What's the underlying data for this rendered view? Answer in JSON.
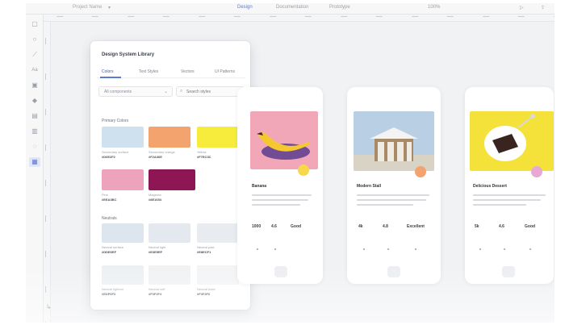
{
  "toolbar": {
    "file_title": "Project Name",
    "file_caret": "▾",
    "tabs": [
      {
        "label": "Design"
      },
      {
        "label": "Documentation"
      },
      {
        "label": "Prototype"
      }
    ],
    "zoom": "100%",
    "icons": [
      "play-icon",
      "share-icon"
    ]
  },
  "rail": {
    "tools": [
      {
        "name": "select-tool-icon",
        "glyph": "▢"
      },
      {
        "name": "ellipse-tool-icon",
        "glyph": "○"
      },
      {
        "name": "pen-tool-icon",
        "glyph": "⟋"
      },
      {
        "name": "text-tool-icon",
        "glyph": "Aa"
      },
      {
        "name": "image-tool-icon",
        "glyph": "▣"
      },
      {
        "name": "component-tool-icon",
        "glyph": "◆"
      },
      {
        "name": "grid-tool-icon",
        "glyph": "▤"
      },
      {
        "name": "layers-tool-icon",
        "glyph": "▥"
      },
      {
        "name": "comment-tool-icon",
        "glyph": "◌"
      },
      {
        "name": "library-tool-icon",
        "glyph": "▦",
        "active": true
      }
    ],
    "bottom_tool": {
      "name": "help-icon",
      "glyph": "↳"
    }
  },
  "library": {
    "title": "Design System Library",
    "tabs": [
      "Colors",
      "Text Styles",
      "Vectors",
      "UI Patterns"
    ],
    "active_tab": "Colors",
    "filter": {
      "value": "All components"
    },
    "search": {
      "placeholder": "Search styles"
    },
    "primary_label": "Primary Colors",
    "neutral_label": "Neutrals",
    "primary_colors": [
      {
        "color": "#cfe0ef",
        "caption": "Secondary surface",
        "code": "#D0E2F2"
      },
      {
        "color": "#f2a36e",
        "caption": "Secondary orange",
        "code": "#F2A36E"
      },
      {
        "color": "#f7ec3c",
        "caption": "Yellow",
        "code": "#F7EC3C"
      },
      {
        "color": "#eea3bc",
        "caption": "Pink",
        "code": "#EEA3BC"
      },
      {
        "color": "#8e1654",
        "caption": "Magenta",
        "code": "#8E1654"
      }
    ],
    "neutral_colors": [
      {
        "color": "#dde6ef",
        "caption": "Neutral surface",
        "code": "#DDE6EF"
      },
      {
        "color": "#e3e9ef",
        "caption": "Neutral light",
        "code": "#E3E9EF"
      },
      {
        "color": "#e8ecf1",
        "caption": "Neutral pale",
        "code": "#E8ECF1"
      },
      {
        "color": "#edf0f3",
        "caption": "Neutral lightest",
        "code": "#EDF0F3"
      },
      {
        "color": "#f0f2f4",
        "caption": "Neutral soft",
        "code": "#F0F2F4"
      },
      {
        "color": "#f3f4f6",
        "caption": "Neutral base",
        "code": "#F3F4F6"
      }
    ]
  },
  "cards": [
    {
      "title": "Banana",
      "stats": [
        "1000",
        "4.6",
        "Good"
      ],
      "image_color": "#f2a7b9",
      "badge_color": "#f7d84a"
    },
    {
      "title": "Modern Stall",
      "stats": [
        "4k",
        "4.8",
        "Excellent"
      ],
      "image_color": "#b9cfe3",
      "badge_color": "#f2a36e"
    },
    {
      "title": "Delicious Dessert",
      "stats": [
        "5k",
        "4.6",
        "Good"
      ],
      "image_color": "#f4e23a",
      "badge_color": "#e7a9d4"
    }
  ]
}
